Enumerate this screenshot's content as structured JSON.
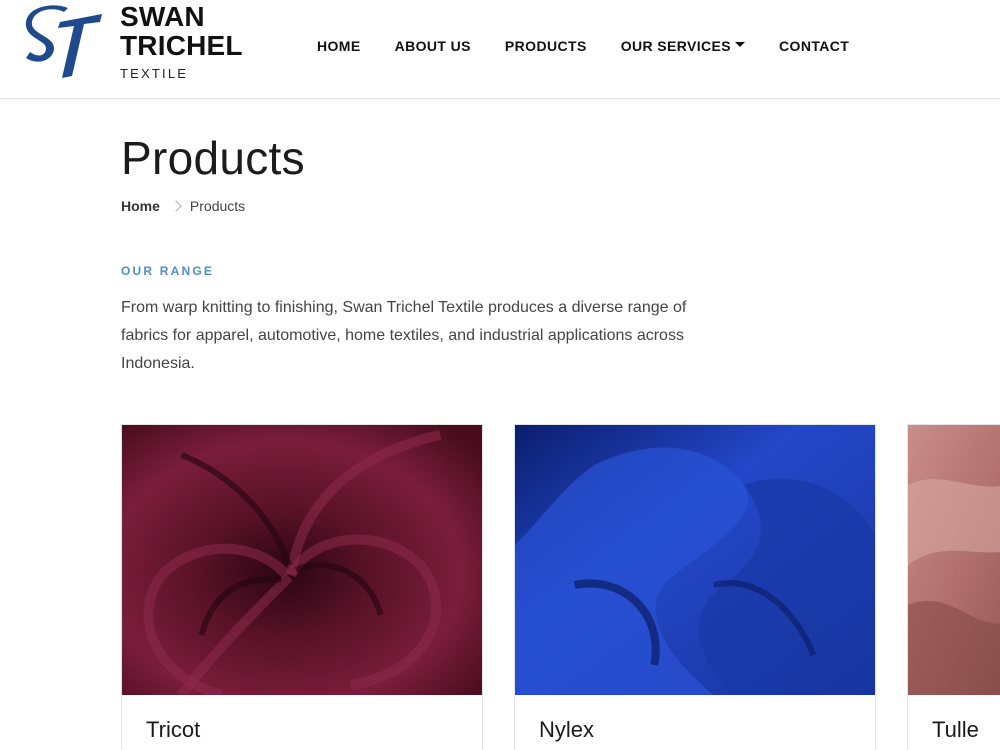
{
  "brand": {
    "monogram": "ST",
    "name_line1": "SWAN",
    "name_line2": "TRICHEL",
    "sub": "TEXTILE",
    "color": "#1f4a8c"
  },
  "nav": {
    "items": [
      {
        "label": "HOME"
      },
      {
        "label": "ABOUT US"
      },
      {
        "label": "PRODUCTS"
      },
      {
        "label": "OUR SERVICES",
        "has_dropdown": true
      },
      {
        "label": "CONTACT"
      }
    ]
  },
  "page": {
    "title": "Products",
    "breadcrumb": {
      "home": "Home",
      "current": "Products"
    },
    "eyebrow": "OUR RANGE",
    "intro": "From warp knitting to finishing, Swan Trichel Textile produces a diverse range of fabrics for apparel, automotive, home textiles, and industrial applications across Indonesia."
  },
  "products": [
    {
      "name": "Tricot",
      "image": "burgundy-fabric-swirl",
      "color": "#6b1533"
    },
    {
      "name": "Nylex",
      "image": "royal-blue-fabric-folds",
      "color": "#1f3fbf"
    },
    {
      "name": "Tulle",
      "image": "dusty-pink-tulle",
      "color": "#b77a78"
    }
  ]
}
